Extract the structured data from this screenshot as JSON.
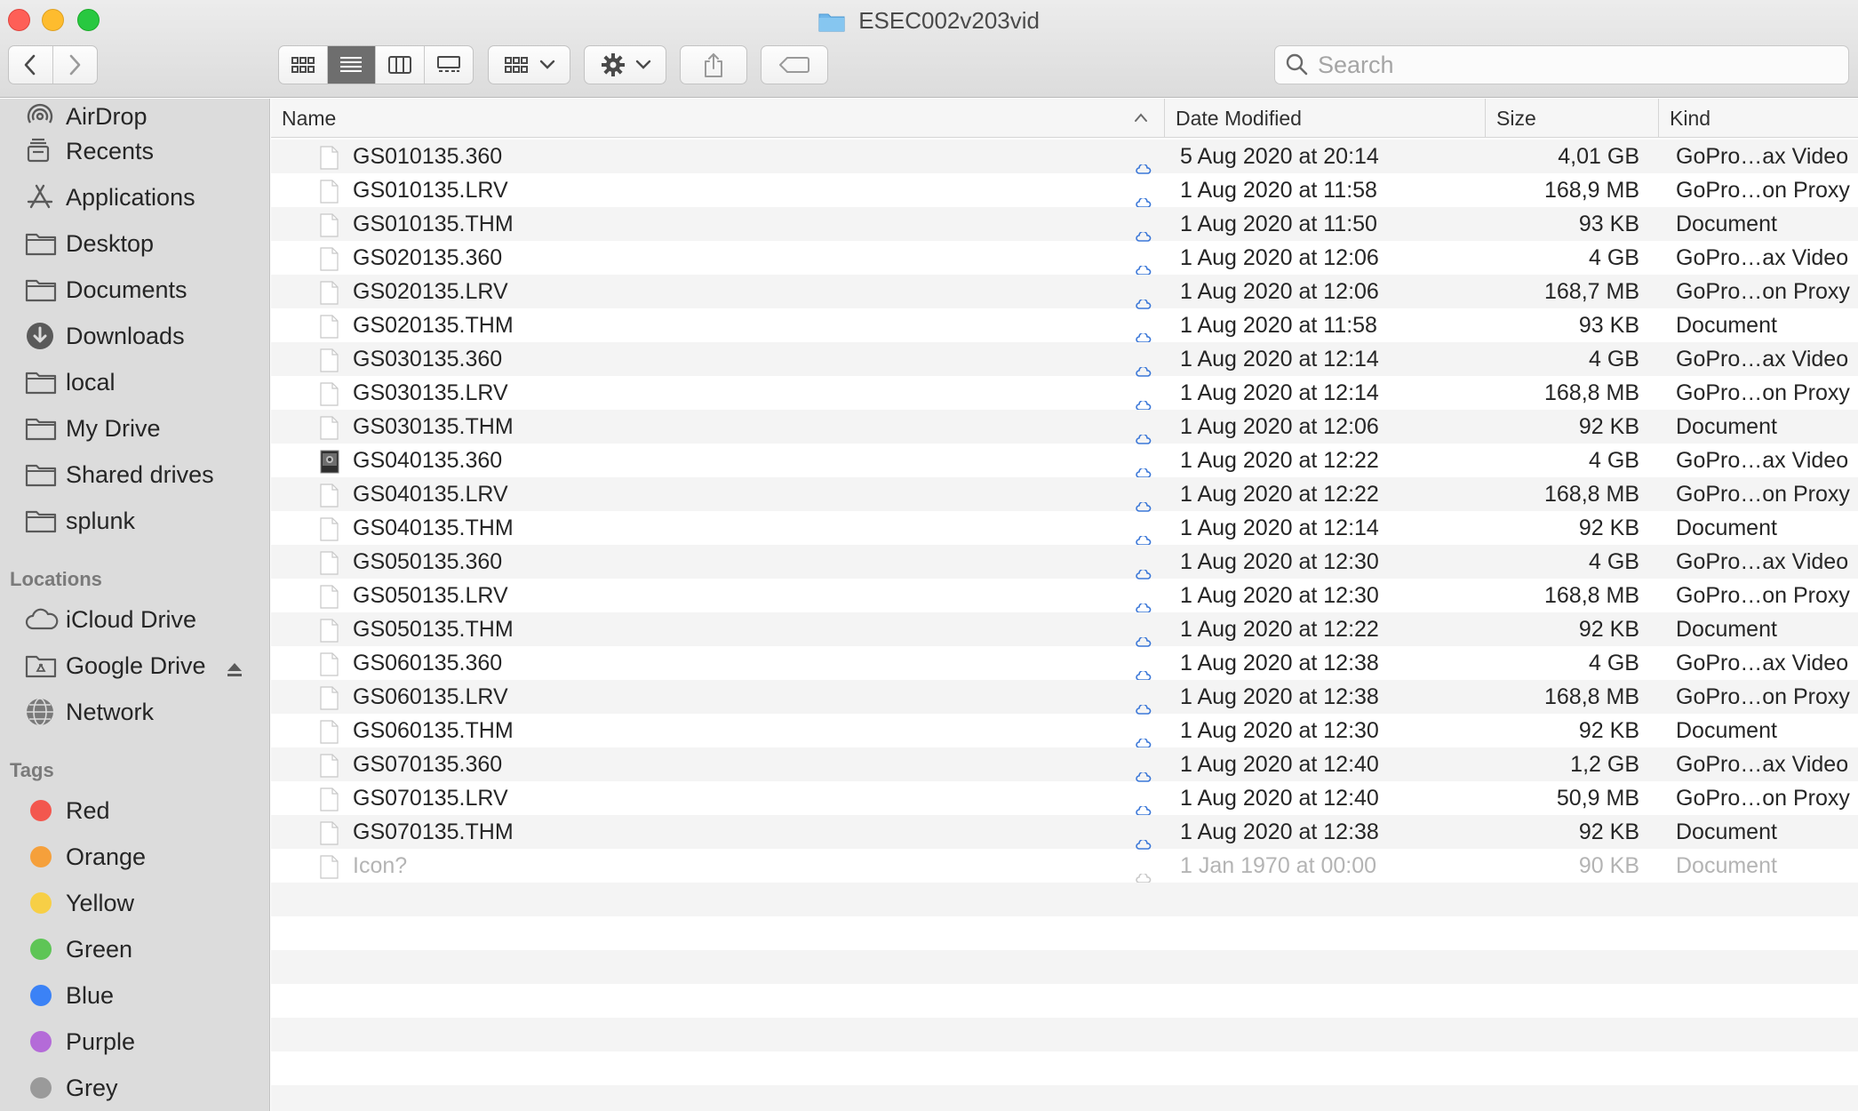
{
  "window": {
    "title": "ESEC002v203vid"
  },
  "toolbar": {
    "back_icon": "chevron-left-icon",
    "forward_icon": "chevron-right-icon",
    "view_modes": [
      "icon-view",
      "list-view",
      "column-view",
      "gallery-view"
    ],
    "selected_view": "list-view",
    "search_placeholder": "Search"
  },
  "sidebar": {
    "favorites": [
      {
        "label": "AirDrop",
        "icon": "airdrop-icon"
      },
      {
        "label": "Recents",
        "icon": "recents-icon"
      },
      {
        "label": "Applications",
        "icon": "applications-icon"
      },
      {
        "label": "Desktop",
        "icon": "folder-icon"
      },
      {
        "label": "Documents",
        "icon": "folder-icon"
      },
      {
        "label": "Downloads",
        "icon": "download-icon"
      },
      {
        "label": "local",
        "icon": "folder-icon"
      },
      {
        "label": "My Drive",
        "icon": "folder-icon"
      },
      {
        "label": "Shared drives",
        "icon": "folder-icon"
      },
      {
        "label": "splunk",
        "icon": "folder-icon"
      }
    ],
    "locations_header": "Locations",
    "locations": [
      {
        "label": "iCloud Drive",
        "icon": "cloud-icon"
      },
      {
        "label": "Google Drive",
        "icon": "drive-icon"
      },
      {
        "label": "Network",
        "icon": "network-icon"
      }
    ],
    "tags_header": "Tags",
    "tags": [
      {
        "label": "Red",
        "color": "#f3574e"
      },
      {
        "label": "Orange",
        "color": "#f5a03b"
      },
      {
        "label": "Yellow",
        "color": "#f7cf46"
      },
      {
        "label": "Green",
        "color": "#5ec556"
      },
      {
        "label": "Blue",
        "color": "#3b82f6"
      },
      {
        "label": "Purple",
        "color": "#b46bd8"
      },
      {
        "label": "Grey",
        "color": "#9a9a9a"
      }
    ]
  },
  "columns": {
    "name": "Name",
    "date": "Date Modified",
    "size": "Size",
    "kind": "Kind"
  },
  "files": [
    {
      "name": "GS010135.360",
      "date": "5 Aug 2020 at 20:14",
      "size": "4,01 GB",
      "kind": "GoPro…ax Video"
    },
    {
      "name": "GS010135.LRV",
      "date": "1 Aug 2020 at 11:58",
      "size": "168,9 MB",
      "kind": "GoPro…on Proxy"
    },
    {
      "name": "GS010135.THM",
      "date": "1 Aug 2020 at 11:50",
      "size": "93 KB",
      "kind": "Document"
    },
    {
      "name": "GS020135.360",
      "date": "1 Aug 2020 at 12:06",
      "size": "4 GB",
      "kind": "GoPro…ax Video"
    },
    {
      "name": "GS020135.LRV",
      "date": "1 Aug 2020 at 12:06",
      "size": "168,7 MB",
      "kind": "GoPro…on Proxy"
    },
    {
      "name": "GS020135.THM",
      "date": "1 Aug 2020 at 11:58",
      "size": "93 KB",
      "kind": "Document"
    },
    {
      "name": "GS030135.360",
      "date": "1 Aug 2020 at 12:14",
      "size": "4 GB",
      "kind": "GoPro…ax Video"
    },
    {
      "name": "GS030135.LRV",
      "date": "1 Aug 2020 at 12:14",
      "size": "168,8 MB",
      "kind": "GoPro…on Proxy"
    },
    {
      "name": "GS030135.THM",
      "date": "1 Aug 2020 at 12:06",
      "size": "92 KB",
      "kind": "Document"
    },
    {
      "name": "GS040135.360",
      "date": "1 Aug 2020 at 12:22",
      "size": "4 GB",
      "kind": "GoPro…ax Video",
      "thumbnail": true
    },
    {
      "name": "GS040135.LRV",
      "date": "1 Aug 2020 at 12:22",
      "size": "168,8 MB",
      "kind": "GoPro…on Proxy"
    },
    {
      "name": "GS040135.THM",
      "date": "1 Aug 2020 at 12:14",
      "size": "92 KB",
      "kind": "Document"
    },
    {
      "name": "GS050135.360",
      "date": "1 Aug 2020 at 12:30",
      "size": "4 GB",
      "kind": "GoPro…ax Video"
    },
    {
      "name": "GS050135.LRV",
      "date": "1 Aug 2020 at 12:30",
      "size": "168,8 MB",
      "kind": "GoPro…on Proxy"
    },
    {
      "name": "GS050135.THM",
      "date": "1 Aug 2020 at 12:22",
      "size": "92 KB",
      "kind": "Document"
    },
    {
      "name": "GS060135.360",
      "date": "1 Aug 2020 at 12:38",
      "size": "4 GB",
      "kind": "GoPro…ax Video"
    },
    {
      "name": "GS060135.LRV",
      "date": "1 Aug 2020 at 12:38",
      "size": "168,8 MB",
      "kind": "GoPro…on Proxy"
    },
    {
      "name": "GS060135.THM",
      "date": "1 Aug 2020 at 12:30",
      "size": "92 KB",
      "kind": "Document"
    },
    {
      "name": "GS070135.360",
      "date": "1 Aug 2020 at 12:40",
      "size": "1,2 GB",
      "kind": "GoPro…ax Video"
    },
    {
      "name": "GS070135.LRV",
      "date": "1 Aug 2020 at 12:40",
      "size": "50,9 MB",
      "kind": "GoPro…on Proxy"
    },
    {
      "name": "GS070135.THM",
      "date": "1 Aug 2020 at 12:38",
      "size": "92 KB",
      "kind": "Document"
    },
    {
      "name": "Icon?",
      "date": "1 Jan 1970 at 00:00",
      "size": "90 KB",
      "kind": "Document",
      "hidden": true
    }
  ],
  "colors": {
    "accent": "#6e6e6e",
    "cloud_status": "#3c78d8"
  }
}
